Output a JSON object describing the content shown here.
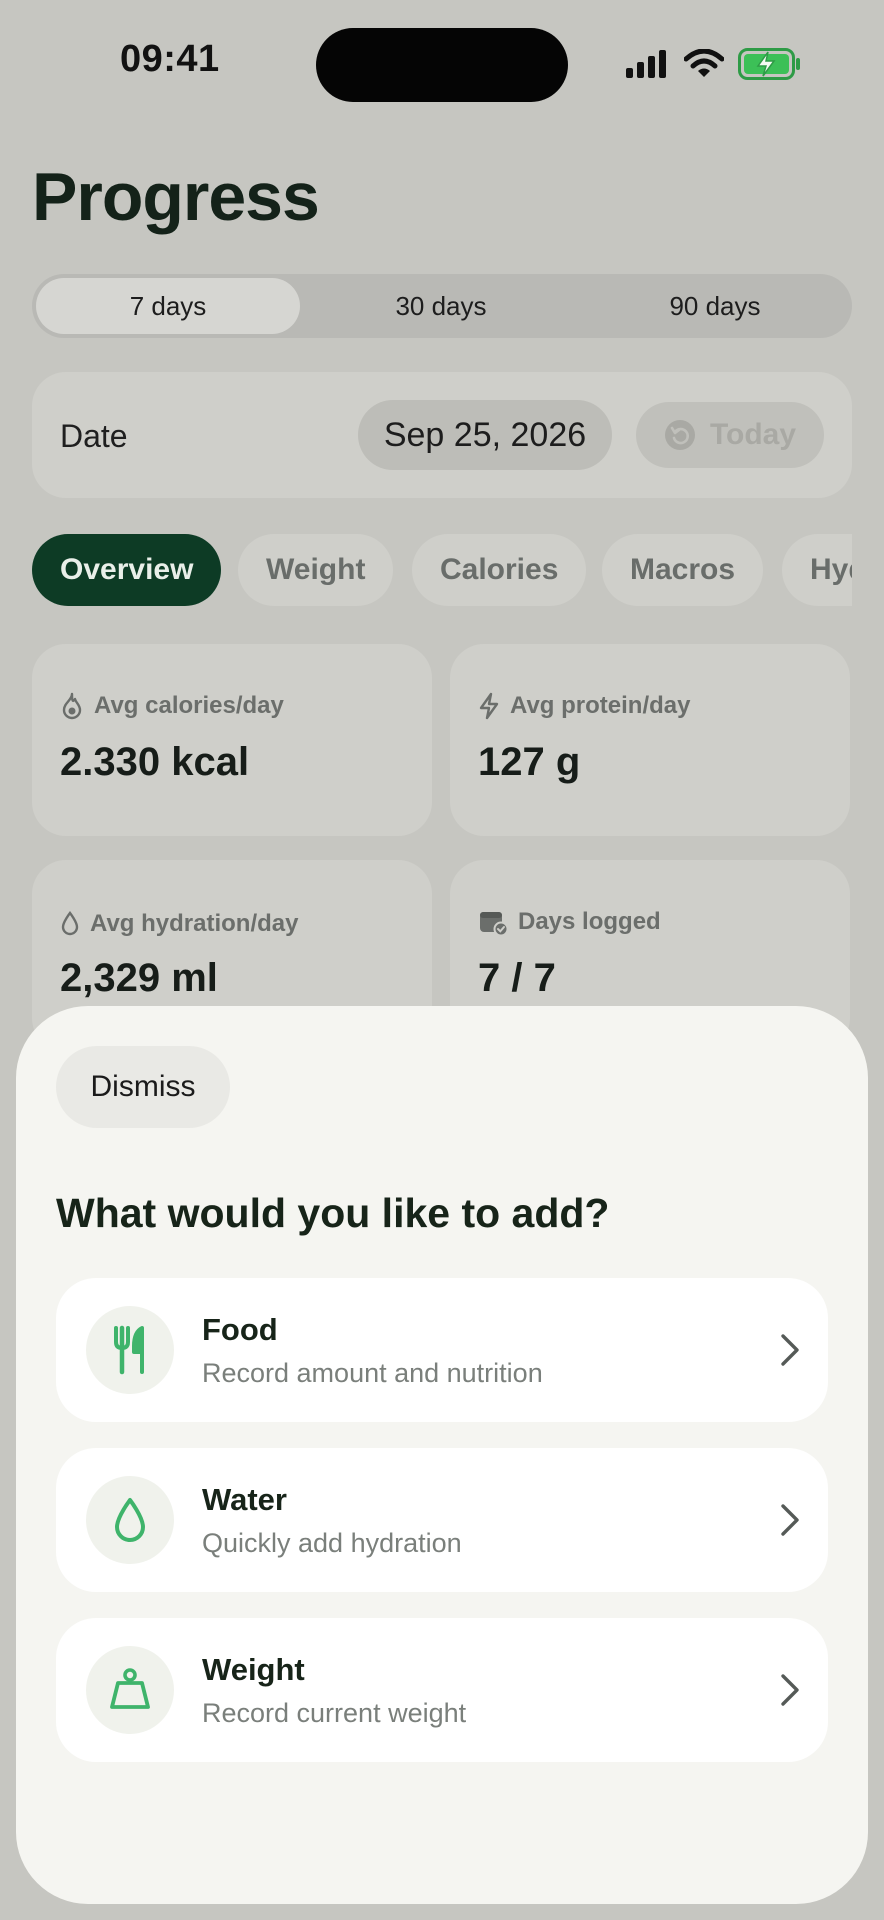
{
  "status_bar": {
    "time": "09:41"
  },
  "header": {
    "title": "Progress"
  },
  "range": {
    "options": [
      "7 days",
      "30 days",
      "90 days"
    ],
    "selected": "7 days"
  },
  "date": {
    "label": "Date",
    "value": "Sep 25, 2026",
    "today_label": "Today"
  },
  "tabs": {
    "items": [
      "Overview",
      "Weight",
      "Calories",
      "Macros",
      "Hydration"
    ],
    "selected": "Overview"
  },
  "stats": [
    {
      "label": "Avg calories/day",
      "value": "2.330 kcal",
      "icon": "flame-icon"
    },
    {
      "label": "Avg protein/day",
      "value": "127 g",
      "icon": "bolt-icon"
    },
    {
      "label": "Avg hydration/day",
      "value": "2,329 ml",
      "icon": "droplet-icon"
    },
    {
      "label": "Days logged",
      "value": "7 / 7",
      "icon": "calendar-check-icon"
    }
  ],
  "sheet": {
    "dismiss_label": "Dismiss",
    "title": "What would you like to add?",
    "options": [
      {
        "title": "Food",
        "subtitle": "Record amount and nutrition",
        "icon": "fork-knife-icon"
      },
      {
        "title": "Water",
        "subtitle": "Quickly add hydration",
        "icon": "droplet-icon"
      },
      {
        "title": "Weight",
        "subtitle": "Record current weight",
        "icon": "scale-icon"
      }
    ]
  },
  "colors": {
    "accent": "#0d3b25",
    "icon_green": "#3fb46b",
    "background": "#c6c6c1",
    "sheet": "#f5f5f1"
  }
}
